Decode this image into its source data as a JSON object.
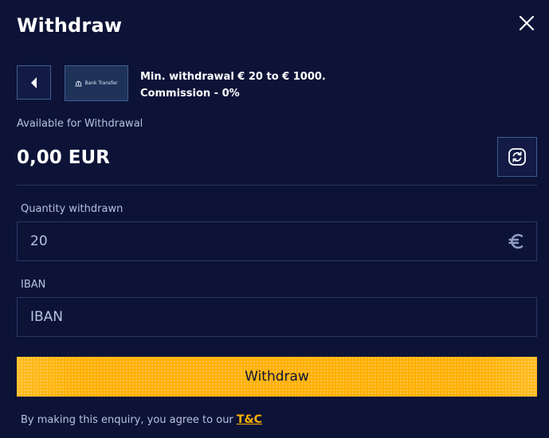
{
  "header": {
    "title": "Withdraw"
  },
  "method": {
    "tile_label": "Bank Transfer",
    "info_line1": "Min. withdrawal € 20 to € 1000.",
    "info_line2": "Commission - 0%"
  },
  "balance": {
    "label": "Available for Withdrawal",
    "amount": "0,00 EUR"
  },
  "form": {
    "quantity_label": "Quantity withdrawn",
    "quantity_value": "20",
    "iban_label": "IBAN",
    "iban_placeholder": "IBAN"
  },
  "actions": {
    "withdraw_label": "Withdraw"
  },
  "footer": {
    "terms_text": "By making this enquiry, you agree to our ",
    "terms_link": "T&C"
  },
  "icons": {
    "close": "close-icon",
    "back": "caret-left-icon",
    "bank": "bank-icon",
    "refresh": "refresh-icon",
    "currency": "euro-icon"
  },
  "colors": {
    "background": "#0c1337",
    "accent": "#ffaf00",
    "muted_text": "#b8c1de",
    "border": "#2b3665"
  }
}
